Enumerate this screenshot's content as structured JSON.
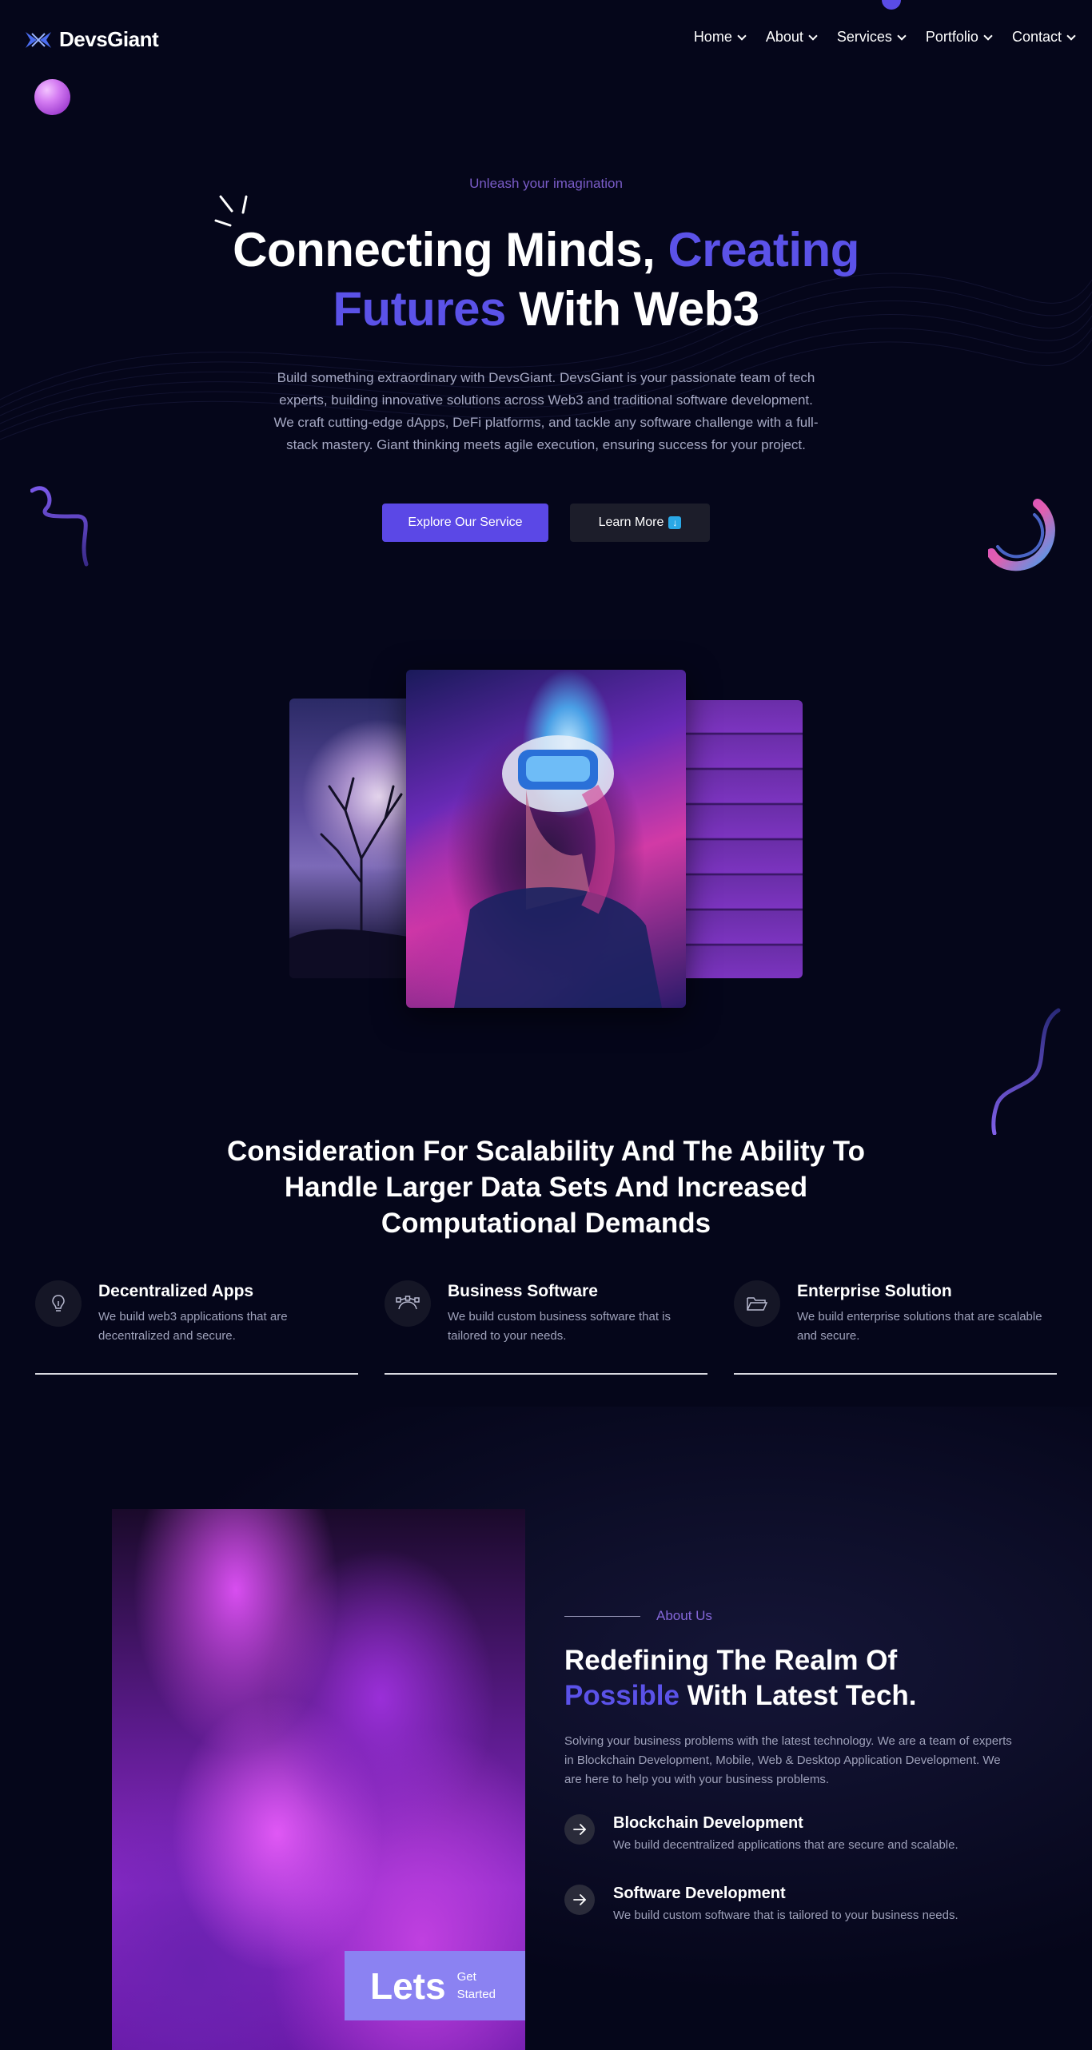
{
  "header": {
    "logo_text": "DevsGiant",
    "nav": [
      {
        "label": "Home"
      },
      {
        "label": "About"
      },
      {
        "label": "Services"
      },
      {
        "label": "Portfolio"
      },
      {
        "label": "Contact"
      }
    ]
  },
  "hero": {
    "eyebrow": "Unleash your imagination",
    "title_part1": "Connecting Minds, ",
    "title_accent1": "Creating",
    "title_accent2": "Futures",
    "title_part2": " With Web3",
    "description": "Build something extraordinary with DevsGiant. DevsGiant is your passionate team of tech experts, building innovative solutions across Web3 and traditional software development. We craft cutting-edge dApps, DeFi platforms, and tackle any software challenge with a full-stack mastery. Giant thinking meets agile execution, ensuring success for your project.",
    "primary_button": "Explore Our Service",
    "secondary_button": "Learn More"
  },
  "features": {
    "title": "Consideration For Scalability And The Ability To Handle Larger Data Sets And Increased Computational Demands",
    "items": [
      {
        "title": "Decentralized Apps",
        "description": "We build web3 applications that are decentralized and secure.",
        "icon": "lightbulb-icon"
      },
      {
        "title": "Business Software",
        "description": "We build custom business software that is tailored to your needs.",
        "icon": "bezier-icon"
      },
      {
        "title": "Enterprise Solution",
        "description": "We build enterprise solutions that are scalable and secure.",
        "icon": "folder-icon"
      }
    ]
  },
  "about": {
    "eyebrow": "About Us",
    "title_part1": "Redefining The Realm Of",
    "title_accent": "Possible",
    "title_part2": " With Latest Tech.",
    "description": "Solving your business problems with the latest technology. We are a team of experts in Blockchain Development, Mobile, Web & Desktop Application Development. We are here to help you with your business problems.",
    "services": [
      {
        "title": "Blockchain Development",
        "description": "We build decentralized applications that are secure and scalable."
      },
      {
        "title": "Software Development",
        "description": "We build custom software that is tailored to your business needs."
      }
    ],
    "cta_big": "Lets",
    "cta_small": "Get Started"
  },
  "colors": {
    "background": "#05061a",
    "accent": "#5b52e8",
    "primary_button": "#5b48e6",
    "eyebrow": "#7a5cc8",
    "cta_box": "#8b82f2"
  }
}
